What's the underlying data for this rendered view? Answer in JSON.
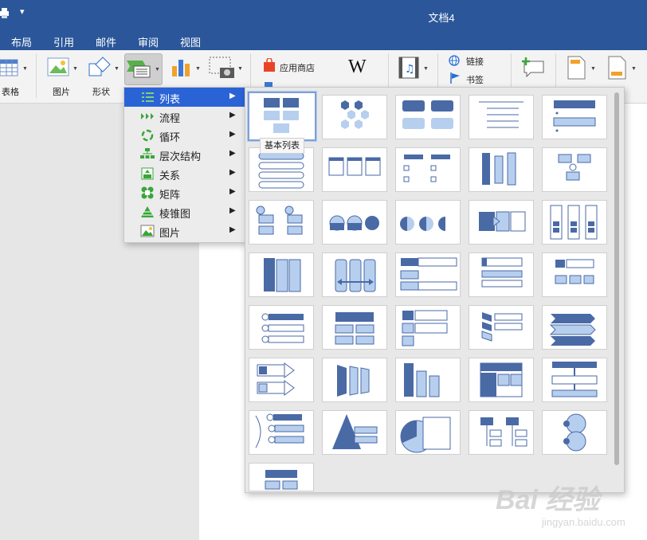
{
  "window": {
    "title": "文档4"
  },
  "tabs": [
    "布局",
    "引用",
    "邮件",
    "审阅",
    "视图"
  ],
  "ribbon": {
    "table_label": "表格",
    "picture_label": "图片",
    "shapes_label": "形状",
    "app_store_label": "应用商店",
    "link_label": "链接",
    "bookmark_label": "书签"
  },
  "smartart_menu": {
    "items": [
      {
        "label": "列表",
        "icon": "list-icon",
        "active": true
      },
      {
        "label": "流程",
        "icon": "process-icon",
        "active": false
      },
      {
        "label": "循环",
        "icon": "cycle-icon",
        "active": false
      },
      {
        "label": "层次结构",
        "icon": "hierarchy-icon",
        "active": false
      },
      {
        "label": "关系",
        "icon": "relationship-icon",
        "active": false
      },
      {
        "label": "矩阵",
        "icon": "matrix-icon",
        "active": false
      },
      {
        "label": "棱锥图",
        "icon": "pyramid-icon",
        "active": false
      },
      {
        "label": "图片",
        "icon": "picture-icon",
        "active": false
      }
    ]
  },
  "gallery": {
    "tooltip": "基本列表",
    "selected_index": 0,
    "thumbnails": 36
  },
  "watermark": {
    "text": "Bai 经验",
    "sub": "jingyan.baidu.com"
  },
  "colors": {
    "accent": "#2b579a",
    "menu_highlight": "#2a63d6",
    "shape_dark": "#4a6aa6",
    "shape_light": "#b7cfee"
  }
}
